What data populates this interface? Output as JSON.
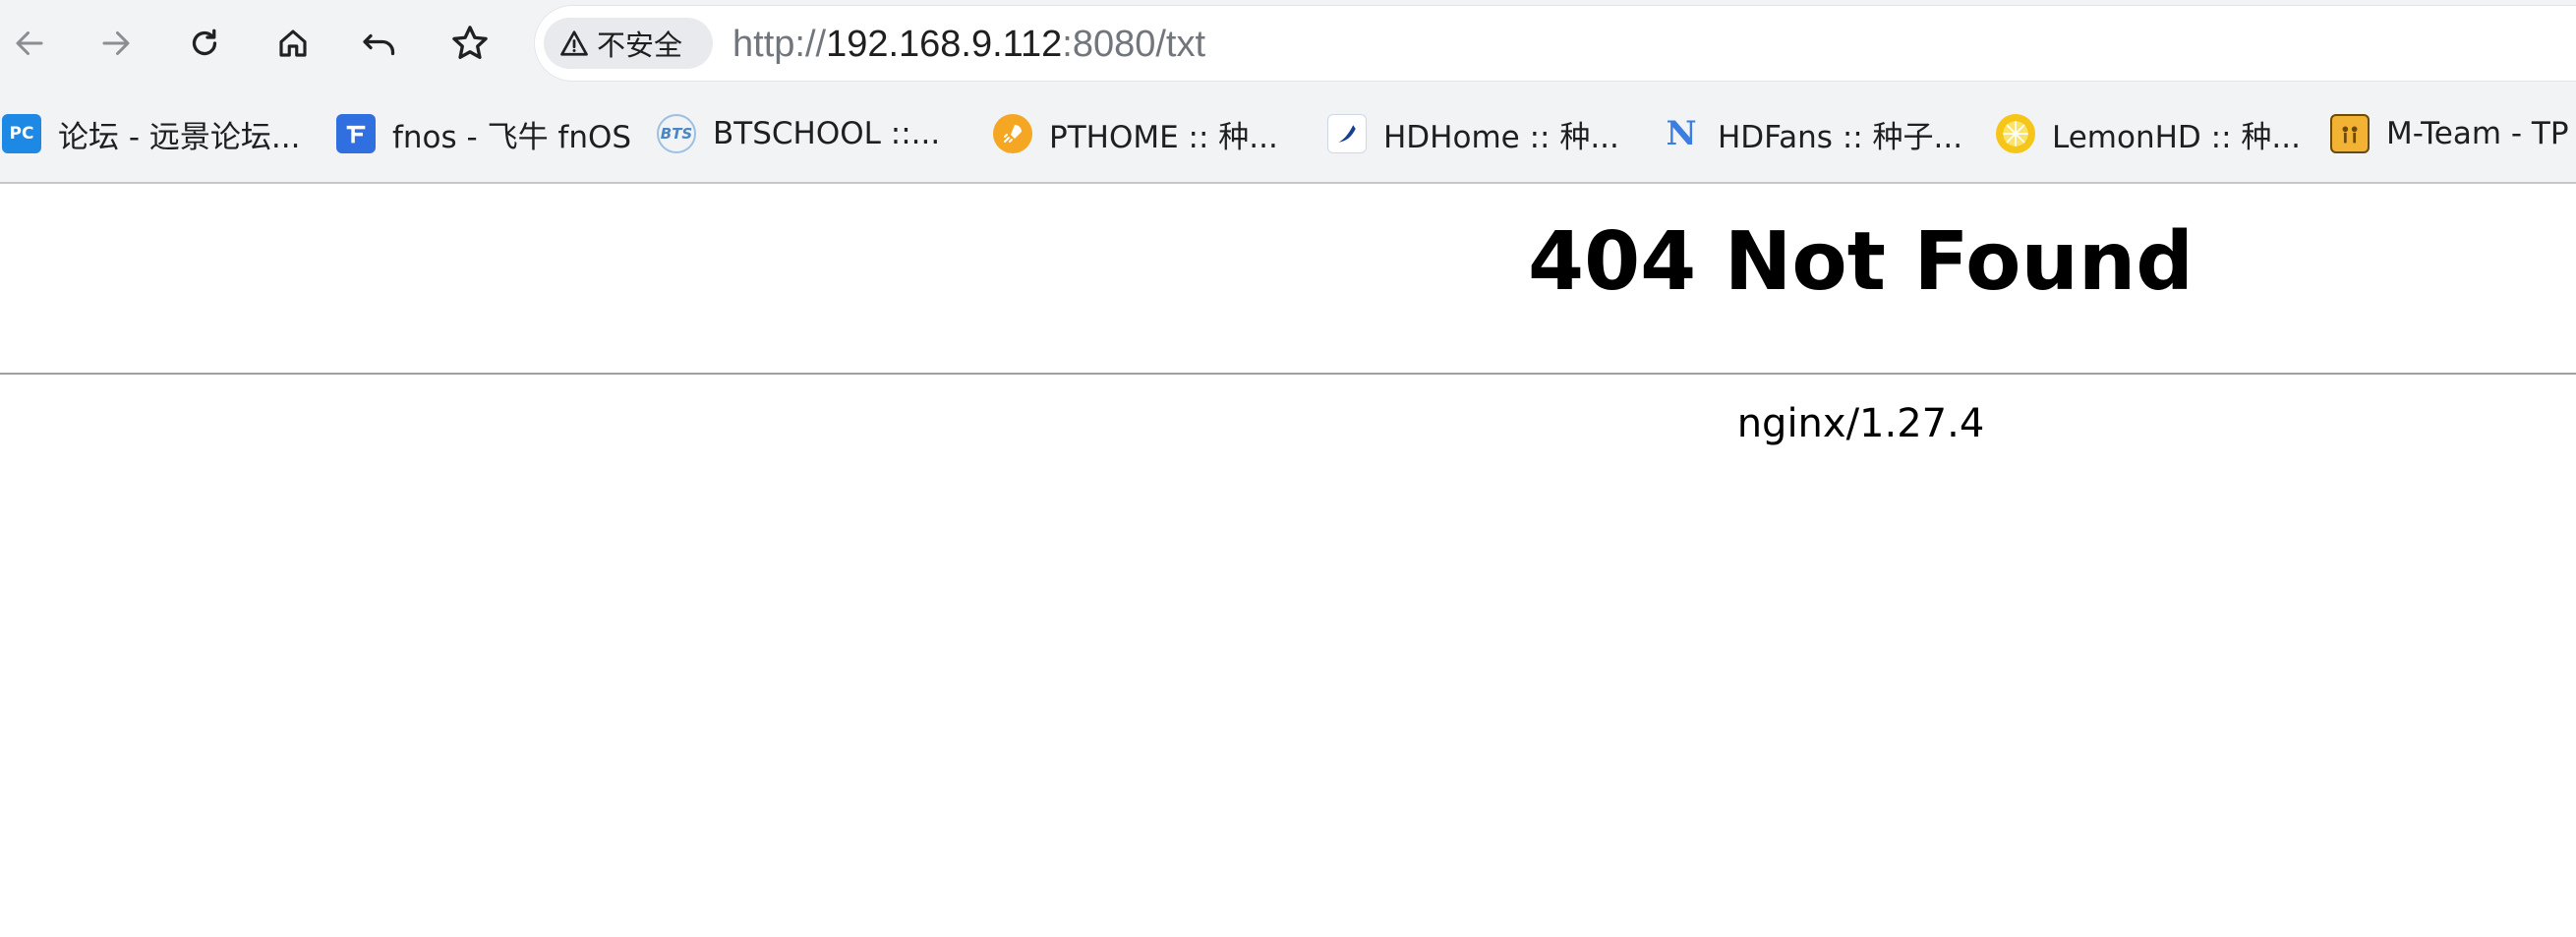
{
  "toolbar": {
    "buttons": [
      {
        "name": "back-button",
        "icon": "arrow-left-icon",
        "enabled": false
      },
      {
        "name": "forward-button",
        "icon": "arrow-right-icon",
        "enabled": false
      },
      {
        "name": "reload-button",
        "icon": "reload-icon",
        "enabled": true
      },
      {
        "name": "home-button",
        "icon": "home-icon",
        "enabled": true
      },
      {
        "name": "undo-button",
        "icon": "undo-icon",
        "enabled": true
      },
      {
        "name": "bookmark-star-button",
        "icon": "star-icon",
        "enabled": true
      }
    ],
    "security_label": "不安全",
    "security_icon": "warning-triangle-icon",
    "url": {
      "scheme": "http://",
      "host": "192.168.9.112",
      "rest": ":8080/txt"
    }
  },
  "bookmarks": [
    {
      "label": "论坛 - 远景论坛...",
      "icon": "pcbeta-icon",
      "color": "#1e88e5"
    },
    {
      "label": "fnos - 飞牛 fnOS",
      "icon": "fnos-icon",
      "color": "#2f6fe0"
    },
    {
      "label": "BTSCHOOL ::...",
      "icon": "bts-icon",
      "color": "#4a86c5"
    },
    {
      "label": "PTHOME :: 种...",
      "icon": "rocket-icon",
      "color": "#f5a623"
    },
    {
      "label": "HDHome :: 种...",
      "icon": "hdhome-icon",
      "color": "#1a3f8f"
    },
    {
      "label": "HDFans :: 种子...",
      "icon": "hdfans-icon",
      "color": "#3b7de0"
    },
    {
      "label": "LemonHD :: 种...",
      "icon": "lemon-icon",
      "color": "#f5c518"
    },
    {
      "label": "M-Team - TP",
      "icon": "mteam-icon",
      "color": "#f2b233"
    }
  ],
  "page": {
    "title": "404 Not Found",
    "server": "nginx/1.27.4"
  }
}
